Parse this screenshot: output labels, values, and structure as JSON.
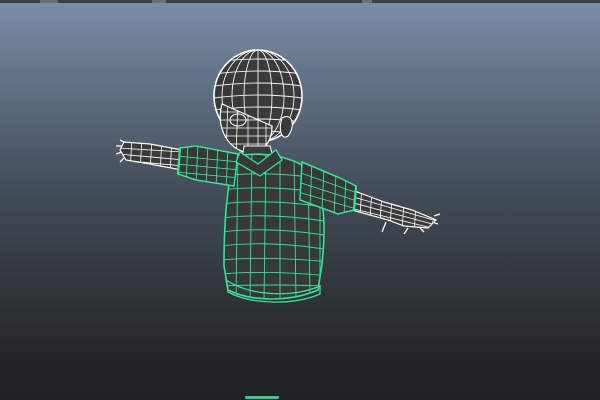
{
  "viewport": {
    "background_top": "#7b8ea8",
    "background_bottom": "#1f2124"
  },
  "model": {
    "name": "character-mesh",
    "selected_wire_color": "#36e39a",
    "unselected_wire_color": "#ffffff",
    "shaded_color": "#3a3a3a",
    "display_mode": "wireframe-on-shaded"
  }
}
